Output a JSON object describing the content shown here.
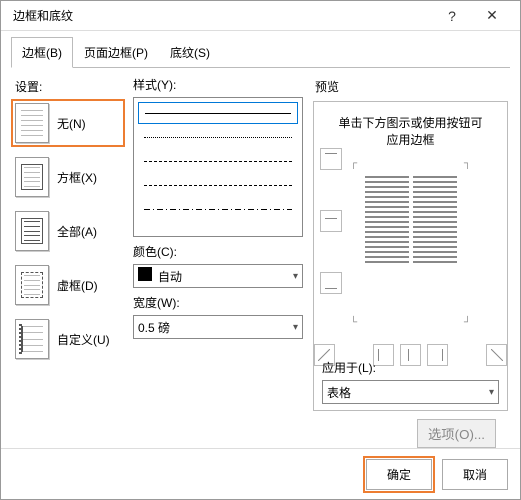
{
  "window": {
    "title": "边框和底纹",
    "help": "?",
    "close": "✕"
  },
  "tabs": {
    "border": "边框(B)",
    "pageBorder": "页面边框(P)",
    "shading": "底纹(S)"
  },
  "settings": {
    "label": "设置:",
    "none": "无(N)",
    "box": "方框(X)",
    "all": "全部(A)",
    "dashed": "虚框(D)",
    "custom": "自定义(U)"
  },
  "style": {
    "label": "样式(Y):",
    "colorLabel": "颜色(C):",
    "colorValue": "自动",
    "widthLabel": "宽度(W):",
    "widthValue": "0.5 磅"
  },
  "preview": {
    "label": "预览",
    "hint1": "单击下方图示或使用按钮可",
    "hint2": "应用边框",
    "applyLabel": "应用于(L):",
    "applyValue": "表格",
    "optionsBtn": "选项(O)..."
  },
  "footer": {
    "ok": "确定",
    "cancel": "取消"
  }
}
